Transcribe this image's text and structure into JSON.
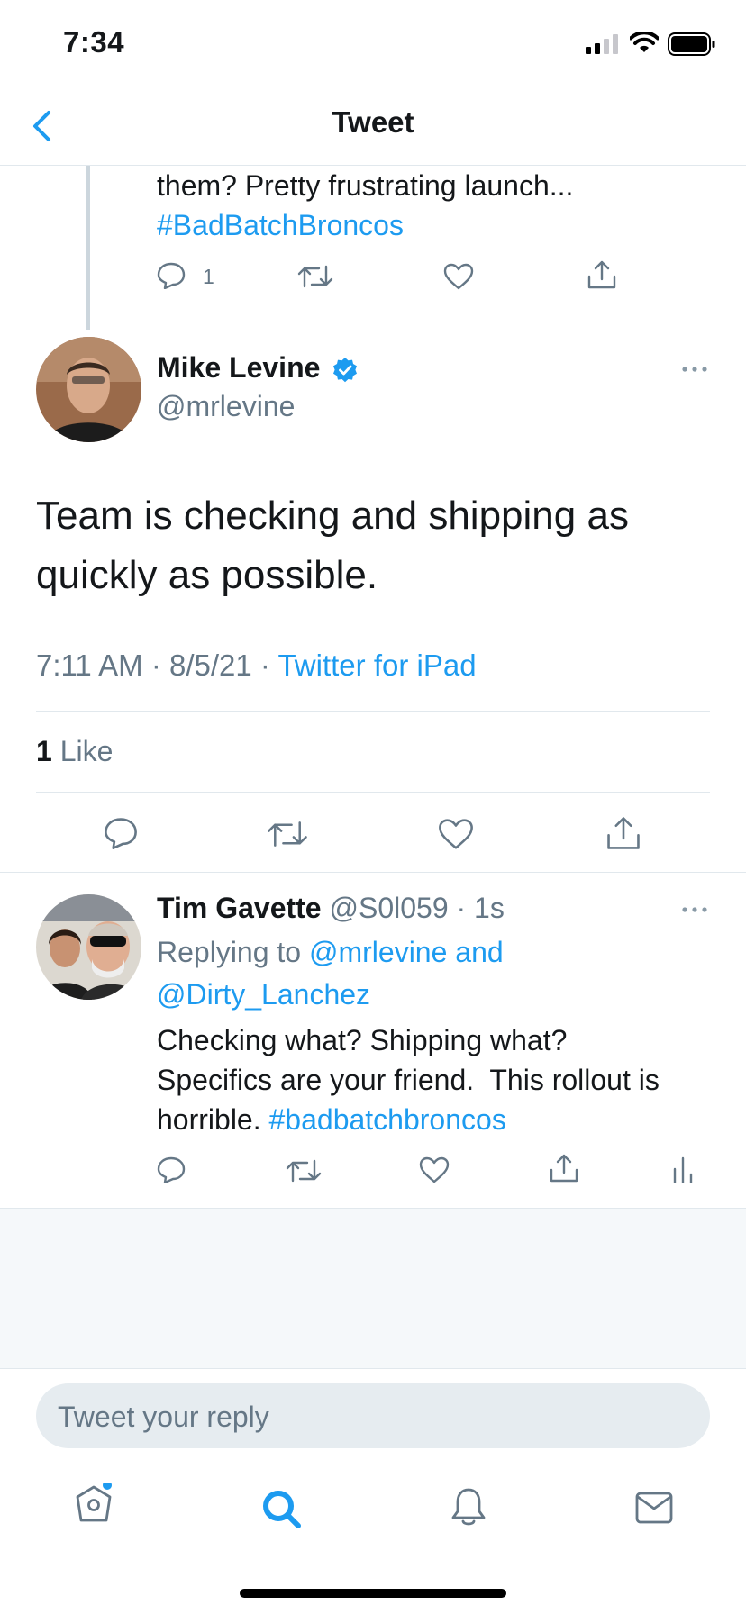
{
  "status_bar": {
    "time": "7:34"
  },
  "nav": {
    "title": "Tweet",
    "back_icon": "chevron-left-icon"
  },
  "previous_tweet": {
    "text_line1": "them? Pretty frustrating launch...",
    "hashtag": "#BadBatchBroncos",
    "reply_count": "1"
  },
  "main_tweet": {
    "author_name": "Mike Levine",
    "author_handle": "@mrlevine",
    "verified": true,
    "text": "Team is checking and shipping as quickly as possible.",
    "time": "7:11 AM",
    "date": "8/5/21",
    "source": "Twitter for iPad",
    "like_count": "1",
    "like_label": "Like"
  },
  "reply_tweet": {
    "author_name": "Tim Gavette",
    "author_handle": "@S0l059",
    "age": "1s",
    "replying_prefix": "Replying to",
    "replying_to_1": "@mrlevine",
    "replying_and": "and",
    "replying_to_2": "@Dirty_Lanchez",
    "text_line1": "Checking what? Shipping what?",
    "text_line2": "Specifics are your friend.  This rollout is",
    "text_line3_prefix": "horrible.",
    "hashtag": "#badbatchbroncos"
  },
  "compose": {
    "placeholder": "Tweet your reply"
  },
  "tab_bar": {
    "items": [
      "home-icon",
      "search-icon",
      "notifications-icon",
      "messages-icon"
    ],
    "active": "search-icon"
  },
  "colors": {
    "accent": "#1d9bf0",
    "secondary_text": "#657786",
    "divider": "#e1e8ed"
  }
}
